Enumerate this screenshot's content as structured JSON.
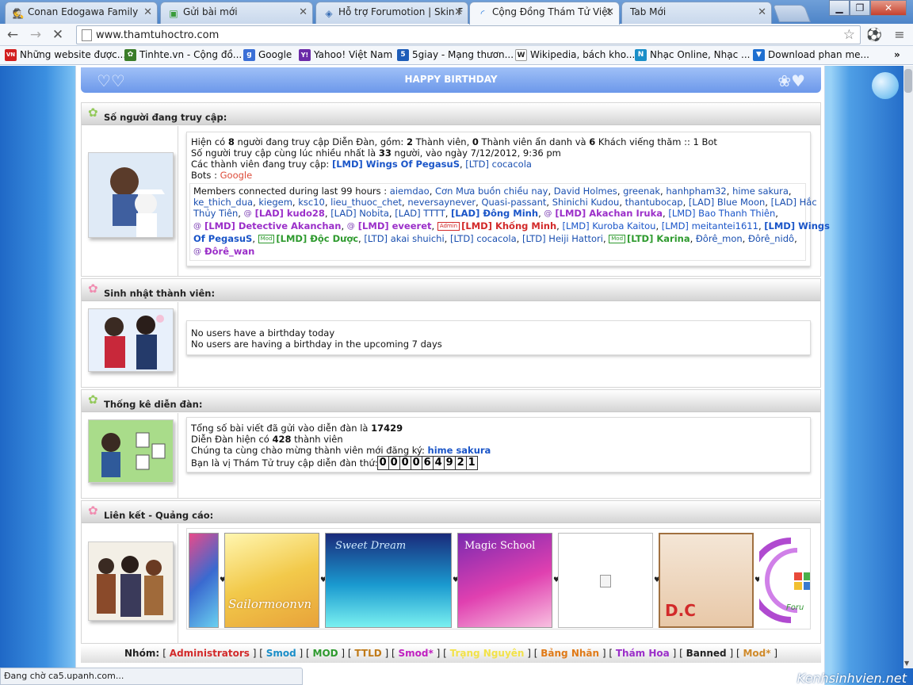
{
  "tabs": [
    {
      "title": "Conan Edogawa Family",
      "icon": "spy-icon"
    },
    {
      "title": "Gửi bài mới",
      "icon": "speech-bubble-icon"
    },
    {
      "title": "Hỗ trợ Forumotion | Skin F",
      "icon": "forum-icon"
    },
    {
      "title": "Cộng Đồng Thám Tử Việt",
      "icon": "loading-spinner-icon"
    },
    {
      "title": "Tab Mới",
      "icon": ""
    }
  ],
  "window_controls": {
    "minimize": "▁",
    "restore": "❐",
    "close": "✕"
  },
  "url": "www.thamtuhoctro.com",
  "bookmarks": [
    {
      "label": "Những website được...",
      "icon": "vn-icon",
      "color": "#d21f1f",
      "glyph": "VN"
    },
    {
      "label": "Tinhte.vn - Cộng đồ...",
      "icon": "tinhte-icon",
      "color": "#3b7d2a",
      "glyph": "✿"
    },
    {
      "label": "Google",
      "icon": "google-icon",
      "color": "#3b6fd6",
      "glyph": "g"
    },
    {
      "label": "Yahoo! Việt Nam",
      "icon": "yahoo-icon",
      "color": "#6b2aa8",
      "glyph": "Y!"
    },
    {
      "label": "5giay - Mạng thươn...",
      "icon": "5giay-icon",
      "color": "#1d5cb8",
      "glyph": "5"
    },
    {
      "label": "Wikipedia, bách kho...",
      "icon": "wikipedia-icon",
      "color": "#444",
      "glyph": "W"
    },
    {
      "label": "Nhạc Online, Nhạc ...",
      "icon": "music-icon",
      "color": "#1a8ec8",
      "glyph": "N"
    },
    {
      "label": "Download phan me...",
      "icon": "download-icon",
      "color": "#1e6fd0",
      "glyph": "▼"
    }
  ],
  "banner": {
    "title": "HAPPY BIRTHDAY"
  },
  "online": {
    "heading": "Số người đang truy cập:",
    "l1a": "Hiện có ",
    "l1n": "8",
    "l1b": " người đang truy cập Diễn Đàn, gồm: ",
    "l1c": "2",
    "l1d": " Thành viên, ",
    "l1e": "0",
    "l1f": " Thành viên ẩn danh và ",
    "l1g": "6",
    "l1h": " Khách viếng thăm :: 1 Bot",
    "l2a": "Số người truy cập cùng lúc nhiều nhất là ",
    "l2n": "33",
    "l2b": " người, vào ngày 7/12/2012, 9:36 pm",
    "l3a": "Các thành viên đang truy cập: ",
    "l3m1": "[LMD] Wings Of PegasuS",
    "l3c": ", ",
    "l3m2": "[LTD] cocacola",
    "bots_label": "Bots : ",
    "bots_val": "Google",
    "members_row1": [
      {
        "t": "Members connected during last 99 hours : ",
        "c": ""
      },
      {
        "t": "aiemdao",
        "c": "c-ltd"
      },
      {
        "t": ", ",
        "c": ""
      },
      {
        "t": "Cơn Mưa buồn chiều nay",
        "c": "c-ltd"
      },
      {
        "t": ", ",
        "c": ""
      },
      {
        "t": "David Holmes",
        "c": "c-ltd"
      },
      {
        "t": ", ",
        "c": ""
      },
      {
        "t": "greenak",
        "c": "c-ltd"
      },
      {
        "t": ", ",
        "c": ""
      },
      {
        "t": "hanhpham32",
        "c": "c-ltd"
      },
      {
        "t": ", ",
        "c": ""
      },
      {
        "t": "hime sakura",
        "c": "c-ltd"
      },
      {
        "t": ",",
        "c": ""
      }
    ],
    "members_row2": [
      {
        "t": "ke_thich_dua",
        "c": "c-ltd"
      },
      {
        "t": ", ",
        "c": ""
      },
      {
        "t": "kiegem",
        "c": "c-ltd"
      },
      {
        "t": ", ",
        "c": ""
      },
      {
        "t": "ksc10",
        "c": "c-ltd"
      },
      {
        "t": ", ",
        "c": ""
      },
      {
        "t": "lieu_thuoc_chet",
        "c": "c-ltd"
      },
      {
        "t": ", ",
        "c": ""
      },
      {
        "t": "neversaynever",
        "c": "c-ltd"
      },
      {
        "t": ", ",
        "c": ""
      },
      {
        "t": "Quasi-passant",
        "c": "c-ltd"
      },
      {
        "t": ", ",
        "c": ""
      },
      {
        "t": "Shinichi Kudou",
        "c": "c-ltd"
      },
      {
        "t": ", ",
        "c": ""
      },
      {
        "t": "thantubocap",
        "c": "c-ltd"
      },
      {
        "t": ", ",
        "c": ""
      },
      {
        "t": "[LAD] Blue Moon",
        "c": "c-lad"
      },
      {
        "t": ", ",
        "c": ""
      },
      {
        "t": "[LAD] Hắc",
        "c": "c-lad"
      }
    ],
    "members_row3": [
      {
        "t": "Thủy Tiên",
        "c": "c-lad"
      },
      {
        "t": ", ",
        "c": ""
      },
      {
        "t": "@",
        "c": "ico"
      },
      {
        "t": "[LAD] kudo28",
        "c": "c-pur"
      },
      {
        "t": ", ",
        "c": ""
      },
      {
        "t": "[LAD] Nobita",
        "c": "c-lad"
      },
      {
        "t": ", ",
        "c": ""
      },
      {
        "t": "[LAD] TTTT",
        "c": "c-lad"
      },
      {
        "t": ", ",
        "c": ""
      },
      {
        "t": "[LAD] Đông Minh",
        "c": "c-blue"
      },
      {
        "t": ", ",
        "c": ""
      },
      {
        "t": "@",
        "c": "ico"
      },
      {
        "t": "[LMD] Akachan Iruka",
        "c": "c-pur"
      },
      {
        "t": ", ",
        "c": ""
      },
      {
        "t": "[LMD] Bao Thanh Thiên",
        "c": "c-lmd"
      },
      {
        "t": ",",
        "c": ""
      }
    ],
    "members_row4": [
      {
        "t": "@",
        "c": "ico"
      },
      {
        "t": "[LMD] Detective Akanchan",
        "c": "c-pur"
      },
      {
        "t": ", ",
        "c": ""
      },
      {
        "t": "@",
        "c": "ico"
      },
      {
        "t": "[LMD] eveeret",
        "c": "c-pur"
      },
      {
        "t": ", ",
        "c": ""
      },
      {
        "t": "Admin",
        "c": "badge adm"
      },
      {
        "t": "[LMD] Khống Minh",
        "c": "c-red"
      },
      {
        "t": ", ",
        "c": ""
      },
      {
        "t": "[LMD] Kuroba Kaitou",
        "c": "c-lmd"
      },
      {
        "t": ", ",
        "c": ""
      },
      {
        "t": "[LMD] meitantei1611",
        "c": "c-lmd"
      },
      {
        "t": ", ",
        "c": ""
      },
      {
        "t": "[LMD] Wings",
        "c": "c-blue"
      }
    ],
    "members_row5": [
      {
        "t": "Of PegasuS",
        "c": "c-blue"
      },
      {
        "t": ", ",
        "c": ""
      },
      {
        "t": "Mod",
        "c": "badge mod"
      },
      {
        "t": "[LMD] Độc Dược",
        "c": "c-grn"
      },
      {
        "t": ", ",
        "c": ""
      },
      {
        "t": "[LTD] akai shuichi",
        "c": "c-ltd"
      },
      {
        "t": ", ",
        "c": ""
      },
      {
        "t": "[LTD] cocacola",
        "c": "c-ltd"
      },
      {
        "t": ", ",
        "c": ""
      },
      {
        "t": "[LTD] Heiji Hattori",
        "c": "c-ltd"
      },
      {
        "t": ", ",
        "c": ""
      },
      {
        "t": "Mod",
        "c": "badge mod"
      },
      {
        "t": "[LTD] Karina",
        "c": "c-grn"
      },
      {
        "t": ", ",
        "c": ""
      },
      {
        "t": "Đôrê_mon",
        "c": "c-ltd"
      },
      {
        "t": ", ",
        "c": ""
      },
      {
        "t": "Đôrê_nidô",
        "c": "c-ltd"
      },
      {
        "t": ",",
        "c": ""
      }
    ],
    "members_row6": [
      {
        "t": "@",
        "c": "ico"
      },
      {
        "t": "Đôrê_wan",
        "c": "c-pur"
      }
    ]
  },
  "birthday": {
    "heading": "Sinh nhật thành viên:",
    "line1": "No users have a birthday today",
    "line2": "No users are having a birthday in the upcoming 7 days"
  },
  "stats": {
    "heading": "Thống kê diễn đàn:",
    "l1a": "Tổng số bài viết đã gửi vào diễn đàn là ",
    "l1n": "17429",
    "l2a": "Diễn Đàn hiện có ",
    "l2n": "428",
    "l2b": " thành viên",
    "l3a": "Chúng ta cùng chào mừng thành viên mới đăng ký: ",
    "l3u": "hime sakura",
    "l4a": "Bạn là vị Thám Tử truy cập diễn đàn thứ:",
    "counter": [
      "0",
      "0",
      "0",
      "0",
      "6",
      "4",
      "9",
      "2",
      "1"
    ]
  },
  "links": {
    "heading": "Liên kết - Quảng cáo:",
    "ads": [
      "Sailormoonvn",
      "Sweet Dream",
      "Magic School",
      "",
      "D.C",
      "Foru"
    ]
  },
  "groups": {
    "label": "Nhóm:",
    "items": [
      {
        "name": "Administrators",
        "color": "#d22a2a"
      },
      {
        "name": "Smod",
        "color": "#1a8ec8"
      },
      {
        "name": "MOD",
        "color": "#2e9a2e"
      },
      {
        "name": "TTLD",
        "color": "#c07a18"
      },
      {
        "name": "Smod*",
        "color": "#c020c0"
      },
      {
        "name": "Trạng Nguyên",
        "color": "#f2e24a"
      },
      {
        "name": "Bảng Nhãn",
        "color": "#e07a18"
      },
      {
        "name": "Thám Hoa",
        "color": "#9b2fc9"
      },
      {
        "name": "Banned",
        "color": "#222222"
      },
      {
        "name": "Mod*",
        "color": "#d08a2a"
      }
    ]
  },
  "status": "Đang chờ ca5.upanh.com...",
  "watermark": "Kenhsinhvien.net"
}
